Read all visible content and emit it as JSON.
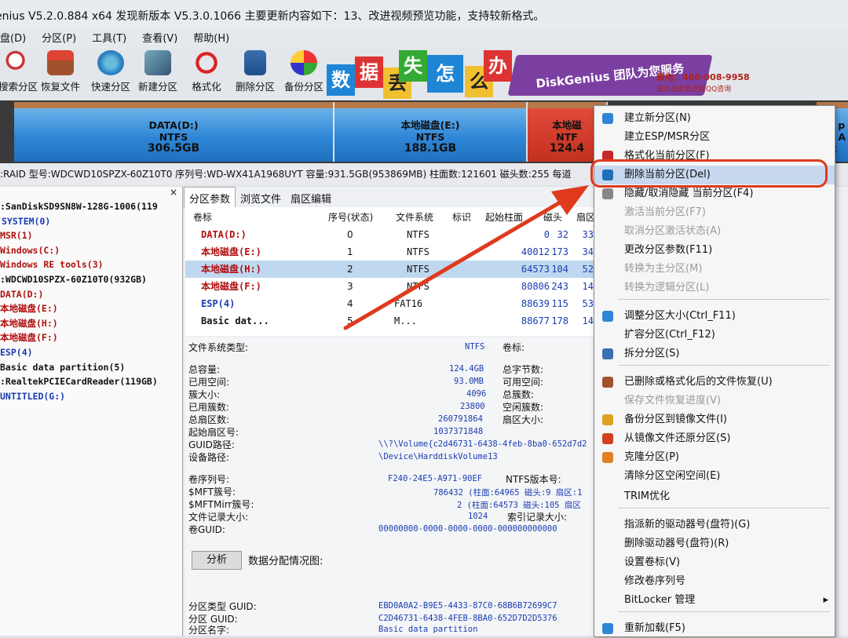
{
  "titlebar": {
    "text": "enius V5.2.0.884 x64   发现新版本 V5.3.0.1066 主要更新内容如下：13、改进视频预览功能，支持较新格式。"
  },
  "menubar": {
    "items": [
      "盘(D)",
      "分区(P)",
      "工具(T)",
      "查看(V)",
      "帮助(H)"
    ]
  },
  "toolbar": {
    "items": [
      "搜索分区",
      "恢复文件",
      "快速分区",
      "新建分区",
      "格式化",
      "删除分区",
      "备份分区"
    ]
  },
  "banner": {
    "tiles": [
      "数",
      "据",
      "丢",
      "失",
      "怎",
      "么",
      "办"
    ],
    "brand": "DiskGenius 团队为您服务",
    "hotline": "致电：400-008-9958",
    "hotline2": "或点击此处连接QQ咨询"
  },
  "diskmap": {
    "segments": [
      {
        "name": "DATA(D:)",
        "fs": "NTFS",
        "size": "306.5GB"
      },
      {
        "name": "本地磁盘(E:)",
        "fs": "NTFS",
        "size": "188.1GB"
      },
      {
        "name": "本地磁",
        "fs": "NTF",
        "size": "124.4"
      },
      {
        "name": "ata p",
        "fs": "S X A",
        "size": "252"
      }
    ]
  },
  "diskinfo": {
    "text": ":RAID  型号:WDCWD10SPZX-60Z10T0  序列号:WD-WX41A1968UYT  容量:931.5GB(953869MB)  柱面数:121601  磁头数:255  每道"
  },
  "tree": {
    "close": "×",
    "nodes": [
      ":SanDiskSD9SN8W-128G-1006(119",
      "SYSTEM(0)",
      "MSR(1)",
      "Windows(C:)",
      "Windows RE tools(3)",
      ":WDCWD10SPZX-60Z10T0(932GB)",
      "DATA(D:)",
      "本地磁盘(E:)",
      "本地磁盘(H:)",
      "本地磁盘(F:)",
      "ESP(4)",
      "Basic data partition(5)",
      ":RealtekPCIECardReader(119GB)",
      "UNTITLED(G:)"
    ]
  },
  "panel": {
    "tabs": [
      "分区参数",
      "浏览文件",
      "扇区编辑"
    ],
    "headers": [
      "卷标",
      "序号(状态)",
      "文件系统",
      "标识",
      "起始柱面",
      "磁头",
      "扇区"
    ],
    "rows": [
      [
        "DATA(D:)",
        "0",
        "NTFS",
        "",
        "0",
        "32",
        "33"
      ],
      [
        "本地磁盘(E:)",
        "1",
        "NTFS",
        "",
        "40012",
        "173",
        "34"
      ],
      [
        "本地磁盘(H:)",
        "2",
        "NTFS",
        "",
        "64573",
        "104",
        "52"
      ],
      [
        "本地磁盘(F:)",
        "3",
        "NTFS",
        "",
        "80806",
        "243",
        "14"
      ],
      [
        "ESP(4)",
        "4",
        "FAT16",
        "",
        "88639",
        "115",
        "53"
      ],
      [
        "Basic dat...",
        "5",
        "M...",
        "",
        "88677",
        "178",
        "14"
      ]
    ],
    "fs": {
      "type_label": "文件系统类型:",
      "type_value": "NTFS",
      "vol_label": "卷标:",
      "total_label": "总容量:",
      "total": "124.4GB",
      "bytes_label": "总字节数:",
      "used_label": "已用空间:",
      "used": "93.0MB",
      "free_label": "可用空间:",
      "cluster_label": "簇大小:",
      "cluster": "4096",
      "clusters_label": "总簇数:",
      "used_clusters_label": "已用簇数:",
      "used_clusters": "23800",
      "free_clusters_label": "空闲簇数:",
      "sectors_label": "总扇区数:",
      "sectors": "260791864",
      "sector_size_label": "扇区大小:",
      "start_label": "起始扇区号:",
      "start": "1037371848",
      "guid_path_label": "GUID路径:",
      "guid_path": "\\\\?\\Volume{c2d46731-6438-4feb-8ba0-652d7d2",
      "dev_path_label": "设备路径:",
      "dev_path": "\\Device\\HarddiskVolume13",
      "serial_label": "卷序列号:",
      "serial": "F240-24E5-A971-90EF",
      "ntfs_ver_label": "NTFS版本号:",
      "mft_label": "$MFT簇号:",
      "mft": "786432 (柱面:64965 磁头:9 扇区:1",
      "mftmirr_label": "$MFTMirr簇号:",
      "mftmirr": "2 (柱面:64573 磁头:105 扇区",
      "record_label": "文件记录大小:",
      "record": "1024",
      "index_label": "索引记录大小:",
      "vguid_label": "卷GUID:",
      "vguid": "00000000-0000-0000-0000-000000000000",
      "analyze": "分析",
      "analyze_caption": "数据分配情况图:",
      "ptype_label": "分区类型 GUID:",
      "ptype": "EBD0A0A2-B9E5-4433-87C0-68B6B72699C7",
      "pguid_label": "分区 GUID:",
      "pguid": "C2D46731-6438-4FEB-8BA0-652D7D2D5376",
      "pname_label": "分区名字:",
      "pname": "Basic data partition"
    }
  },
  "context_menu": {
    "items": [
      {
        "label": "建立新分区(N)",
        "enabled": true,
        "icon": "new-partition-icon",
        "color": "#2f86d6"
      },
      {
        "label": "建立ESP/MSR分区",
        "enabled": true,
        "icon": "",
        "color": ""
      },
      {
        "label": "格式化当前分区(F)",
        "enabled": true,
        "icon": "format-icon",
        "color": "#c62828"
      },
      {
        "label": "删除当前分区(Del)",
        "enabled": true,
        "icon": "delete-icon",
        "color": "#1e6fb8"
      },
      {
        "label": "隐藏/取消隐藏 当前分区(F4)",
        "enabled": true,
        "icon": "hide-icon",
        "color": "#888"
      },
      {
        "label": "激活当前分区(F7)",
        "enabled": false,
        "icon": "",
        "color": ""
      },
      {
        "label": "取消分区激活状态(A)",
        "enabled": false,
        "icon": "",
        "color": ""
      },
      {
        "label": "更改分区参数(F11)",
        "enabled": true,
        "icon": "",
        "color": ""
      },
      {
        "label": "转换为主分区(M)",
        "enabled": false,
        "icon": "",
        "color": ""
      },
      {
        "label": "转换为逻辑分区(L)",
        "enabled": false,
        "icon": "",
        "color": ""
      },
      {
        "label": "调整分区大小(Ctrl_F11)",
        "enabled": true,
        "icon": "resize-icon",
        "color": "#2f86d6"
      },
      {
        "label": "扩容分区(Ctrl_F12)",
        "enabled": true,
        "icon": "",
        "color": ""
      },
      {
        "label": "拆分分区(S)",
        "enabled": true,
        "icon": "split-icon",
        "color": "#3b6fb0"
      },
      {
        "label": "已删除或格式化后的文件恢复(U)",
        "enabled": true,
        "icon": "recover-icon",
        "color": "#a0522d"
      },
      {
        "label": "保存文件恢复进度(V)",
        "enabled": false,
        "icon": "",
        "color": ""
      },
      {
        "label": "备份分区到镜像文件(I)",
        "enabled": true,
        "icon": "backup-icon",
        "color": "#e0a020"
      },
      {
        "label": "从镜像文件还原分区(S)",
        "enabled": true,
        "icon": "restore-icon",
        "color": "#d04020"
      },
      {
        "label": "克隆分区(P)",
        "enabled": true,
        "icon": "clone-icon",
        "color": "#e08020"
      },
      {
        "label": "清除分区空闲空间(E)",
        "enabled": true,
        "icon": "",
        "color": ""
      },
      {
        "label": "TRIM优化",
        "enabled": true,
        "icon": "",
        "color": ""
      },
      {
        "label": "指派新的驱动器号(盘符)(G)",
        "enabled": true,
        "icon": "",
        "color": ""
      },
      {
        "label": "删除驱动器号(盘符)(R)",
        "enabled": true,
        "icon": "",
        "color": ""
      },
      {
        "label": "设置卷标(V)",
        "enabled": true,
        "icon": "",
        "color": ""
      },
      {
        "label": "修改卷序列号",
        "enabled": true,
        "icon": "",
        "color": ""
      },
      {
        "label": "BitLocker 管理",
        "enabled": true,
        "icon": "",
        "color": "",
        "submenu": "▸"
      },
      {
        "label": "重新加载(F5)",
        "enabled": true,
        "icon": "reload-icon",
        "color": "#2f86d6"
      }
    ]
  },
  "colors": {
    "highlight_ring": "#e03a1e",
    "arrow": "#e03a1e",
    "selected_row": "#bfd8f0"
  }
}
